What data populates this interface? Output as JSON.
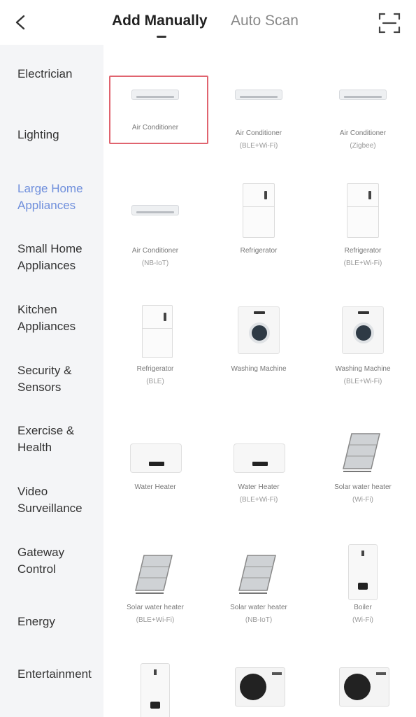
{
  "header": {
    "back_icon": "chevron-left-icon",
    "tab_active": "Add Manually",
    "tab_inactive": "Auto Scan",
    "scan_icon": "scan-frame-icon"
  },
  "sidebar": {
    "active_color": "#6f8fdc",
    "items": [
      {
        "label": "Electrician"
      },
      {
        "label": "Lighting"
      },
      {
        "label": "Large Home Appliances",
        "active": true
      },
      {
        "label": "Small Home Appliances"
      },
      {
        "label": "Kitchen Appliances"
      },
      {
        "label": "Security & Sensors"
      },
      {
        "label": "Exercise & Health"
      },
      {
        "label": "Video Surveillance"
      },
      {
        "label": "Gateway Control"
      },
      {
        "label": "Energy"
      },
      {
        "label": "Entertainment"
      }
    ]
  },
  "devices": [
    {
      "name": "Air Conditioner",
      "sub": "",
      "selected": true
    },
    {
      "name": "Air Conditioner",
      "sub": "(BLE+Wi-Fi)"
    },
    {
      "name": "Air Conditioner",
      "sub": "(Zigbee)"
    },
    {
      "name": "Air Conditioner",
      "sub": "(NB-IoT)"
    },
    {
      "name": "Refrigerator",
      "sub": ""
    },
    {
      "name": "Refrigerator",
      "sub": "(BLE+Wi-Fi)"
    },
    {
      "name": "Refrigerator",
      "sub": "(BLE)"
    },
    {
      "name": "Washing Machine",
      "sub": ""
    },
    {
      "name": "Washing Machine",
      "sub": "(BLE+Wi-Fi)"
    },
    {
      "name": "Water Heater",
      "sub": ""
    },
    {
      "name": "Water Heater",
      "sub": "(BLE+Wi-Fi)"
    },
    {
      "name": "Solar water heater",
      "sub": "(Wi-Fi)"
    },
    {
      "name": "Solar water heater",
      "sub": "(BLE+Wi-Fi)"
    },
    {
      "name": "Solar water heater",
      "sub": "(NB-IoT)"
    },
    {
      "name": "Boiler",
      "sub": "(Wi-Fi)"
    }
  ],
  "colors": {
    "selected_border": "#e0646f",
    "sidebar_bg": "#f4f5f7"
  }
}
